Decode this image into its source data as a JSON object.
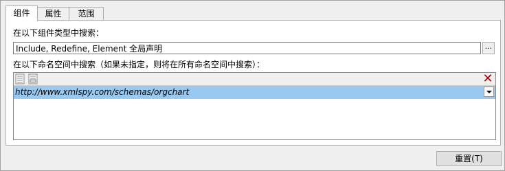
{
  "tabs": [
    {
      "label": "组件",
      "active": true
    },
    {
      "label": "属性",
      "active": false
    },
    {
      "label": "范围",
      "active": false
    }
  ],
  "search_in_types_label": "在以下组件类型中搜索：",
  "component_types_value": "Include, Redefine, Element 全局声明",
  "browse_button_label": "...",
  "namespaces_label": "在以下命名空间中搜索（如果未指定，则将在所有命名空间中搜索）：",
  "namespaces": [
    "http://www.xmlspy.com/schemas/orgchart"
  ],
  "icons": {
    "insert_row": "insert-row-icon",
    "append_row": "append-row-icon",
    "delete_row": "delete-icon",
    "dropdown": "chevron-down-icon"
  },
  "delete_color": "#b00000",
  "selection_color": "#99c9ef",
  "reset_button_label": "重置(T)"
}
